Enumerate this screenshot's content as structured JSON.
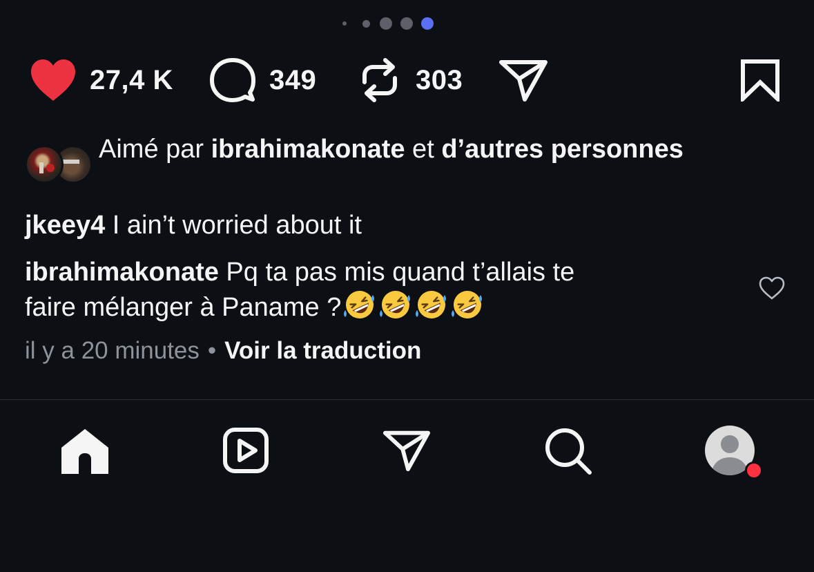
{
  "colors": {
    "background": "#0c0f14",
    "like_red": "#ed3342",
    "active_dot": "#5b6ff5",
    "muted_text": "#8e929a",
    "notification_red": "#ff3040"
  },
  "carousel": {
    "total_dots": 5,
    "active_index": 4
  },
  "actions": {
    "likes_count": "27,4 K",
    "comments_count": "349",
    "reposts_count": "303",
    "like_icon": "heart-icon",
    "comment_icon": "comment-icon",
    "repost_icon": "repost-icon",
    "share_icon": "send-icon",
    "save_icon": "bookmark-icon"
  },
  "liked_by": {
    "prefix": "Aimé par ",
    "user": "ibrahimakonate",
    "connector": " et ",
    "others": "d’autres personnes"
  },
  "caption": {
    "username": "jkeey4",
    "text": " I ain’t worried about it"
  },
  "comment": {
    "username": "ibrahimakonate",
    "text_line1": " Pq ta pas mis quand t’allais te",
    "text_line2": "faire mélanger à Paname ?",
    "emojis": [
      "🤣",
      "🤣",
      "🤣",
      "🤣"
    ]
  },
  "meta": {
    "timestamp": "il y a 20 minutes",
    "separator": "•",
    "translate": "Voir la traduction"
  },
  "bottom_nav": [
    "home-icon",
    "reels-icon",
    "send-icon",
    "search-icon",
    "profile-avatar"
  ]
}
